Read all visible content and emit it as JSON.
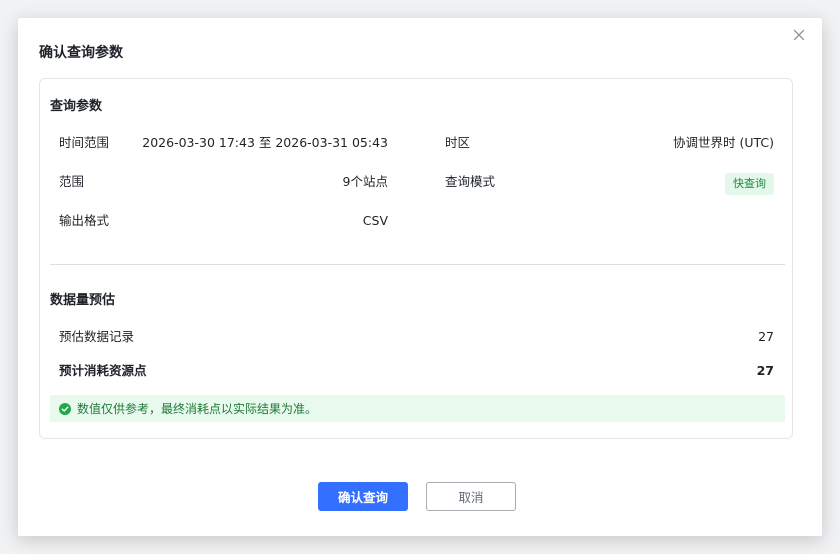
{
  "dialog": {
    "title": "确认查询参数",
    "close_icon": "close-icon"
  },
  "query_params": {
    "section_title": "查询参数",
    "time_range_label": "时间范围",
    "time_range_value": "2026-03-30 17:43 至 2026-03-31 05:43",
    "timezone_label": "时区",
    "timezone_value": "协调世界时 (UTC)",
    "scope_label": "范围",
    "scope_value": "9个站点",
    "query_mode_label": "查询模式",
    "query_mode_value": "快查询",
    "output_format_label": "输出格式",
    "output_format_value": "CSV"
  },
  "estimate": {
    "section_title": "数据量预估",
    "records_label": "预估数据记录",
    "records_value": "27",
    "cost_label": "预计消耗资源点",
    "cost_value": "27",
    "notice_icon": "check-circle-icon",
    "notice_text": "数值仅供参考，最终消耗点以实际结果为准。"
  },
  "buttons": {
    "confirm_label": "确认查询",
    "cancel_label": "取消"
  },
  "colors": {
    "primary": "#3370ff",
    "success_bg": "#e8f9ee",
    "success_text": "#1f7a36",
    "badge_bg": "#e3f7ea",
    "badge_text": "#1f8a3c"
  }
}
